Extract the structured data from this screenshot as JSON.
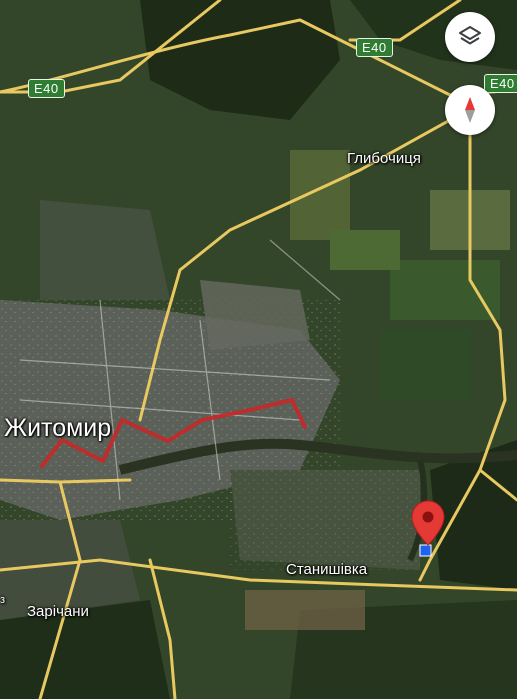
{
  "map": {
    "city": "Житомир",
    "places": {
      "hlybochytsia": "Глибочиця",
      "stanyshivka": "Станишівка",
      "zarichany": "Зарічани"
    },
    "road_shields": [
      "E40",
      "E40",
      "E40"
    ],
    "edge_glyph": "з"
  },
  "controls": {
    "layers_icon": "layers-icon",
    "compass_icon": "compass-icon"
  },
  "colors": {
    "route": "#c62828",
    "pin": "#e53935",
    "road": "#e8c860",
    "shield": "#2e7d32"
  }
}
